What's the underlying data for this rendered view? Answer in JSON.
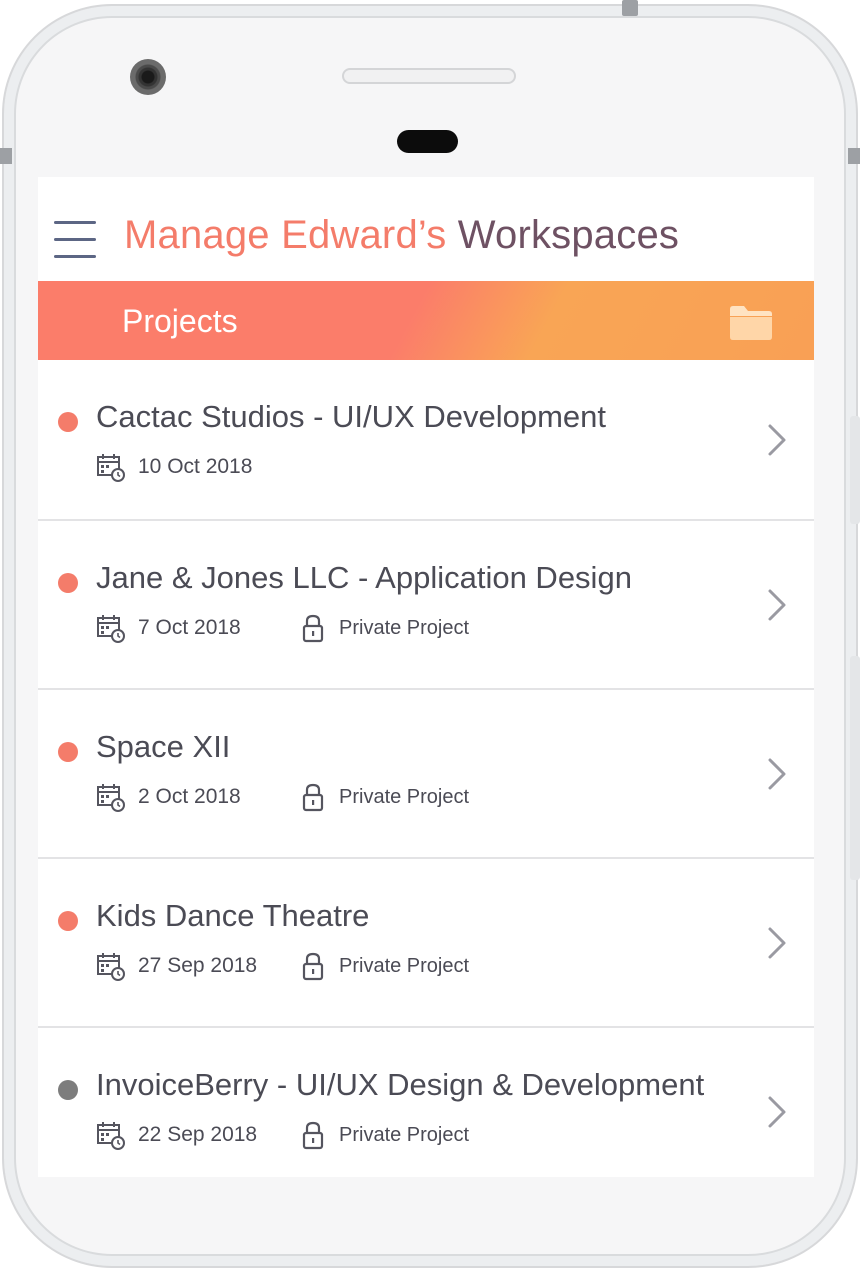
{
  "app": {
    "title_part_a": "Manage Edward’s",
    "title_part_b": " Workspaces"
  },
  "banner": {
    "label": "Projects",
    "icon": "folder-icon"
  },
  "colors": {
    "accent": "#f47c6a",
    "title_secondary": "#6e5163",
    "banner_start": "#fb7d6a",
    "banner_end": "#f9a055",
    "status_active": "#f47c6a",
    "status_inactive": "#7d7d7d"
  },
  "projects": [
    {
      "name": "Cactac Studios - UI/UX Development",
      "date": "10 Oct 2018",
      "privacy": "",
      "status": "active"
    },
    {
      "name": "Jane & Jones LLC - Application Design",
      "date": "7 Oct 2018",
      "privacy": "Private Project",
      "status": "active"
    },
    {
      "name": "Space XII",
      "date": "2 Oct 2018",
      "privacy": "Private Project",
      "status": "active"
    },
    {
      "name": "Kids Dance Theatre",
      "date": "27 Sep 2018",
      "privacy": "Private Project",
      "status": "active"
    },
    {
      "name": "InvoiceBerry - UI/UX Design & Development",
      "date": "22 Sep 2018",
      "privacy": "Private Project",
      "status": "inactive"
    }
  ]
}
